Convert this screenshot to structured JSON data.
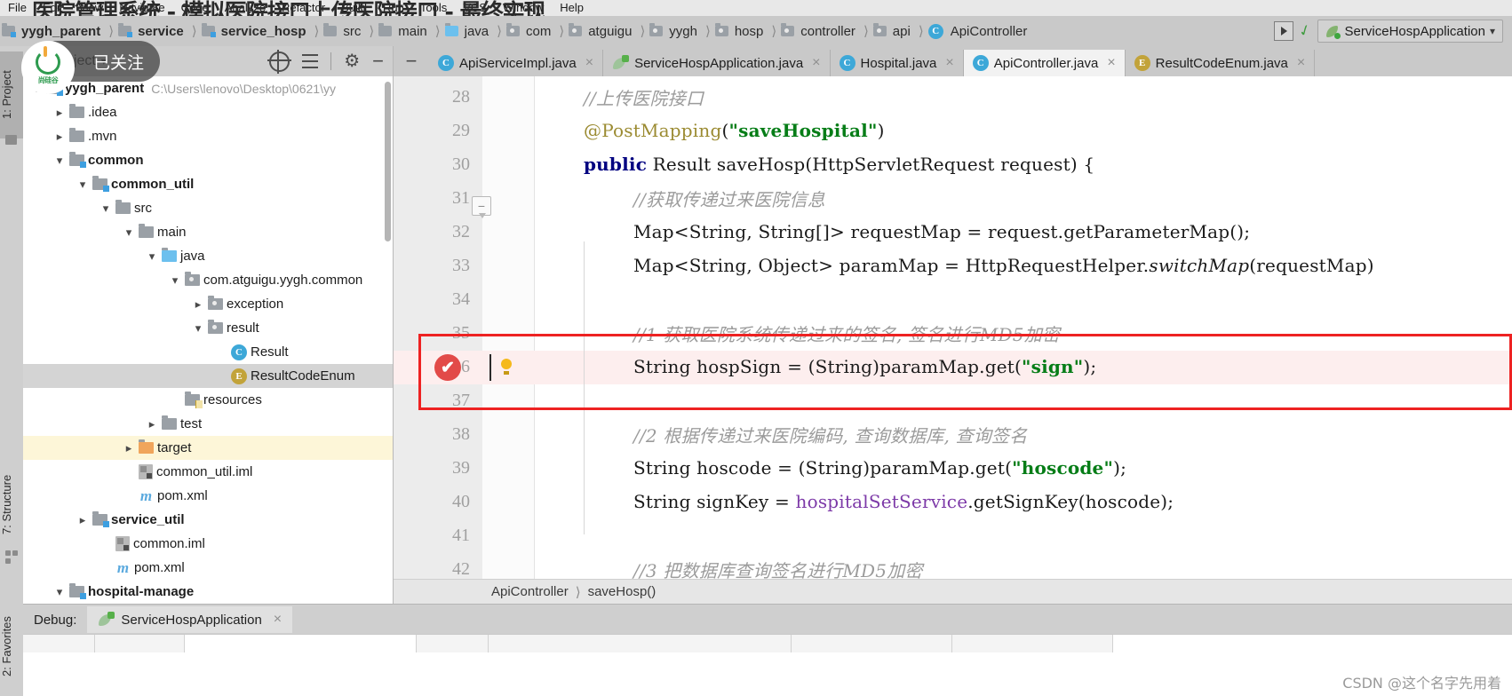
{
  "window": {
    "menu_items": [
      "File",
      "Edit",
      "View",
      "Navigate",
      "Code",
      "Analyze",
      "Refactor",
      "Build",
      "Run",
      "Tools",
      "VCS",
      "Window",
      "Help"
    ],
    "overlay_title": "医院管理系统 - 模拟医院接口上传医院接口 - 最终实现"
  },
  "breadcrumb": {
    "items": [
      {
        "label": "yygh_parent",
        "icon": "module-folder-icon",
        "bold": true
      },
      {
        "label": "service",
        "icon": "module-folder-icon",
        "bold": true
      },
      {
        "label": "service_hosp",
        "icon": "module-folder-icon",
        "bold": true
      },
      {
        "label": "src",
        "icon": "folder-icon",
        "bold": false
      },
      {
        "label": "main",
        "icon": "folder-icon",
        "bold": false
      },
      {
        "label": "java",
        "icon": "source-folder-icon",
        "bold": false
      },
      {
        "label": "com",
        "icon": "package-icon",
        "bold": false
      },
      {
        "label": "atguigu",
        "icon": "package-icon",
        "bold": false
      },
      {
        "label": "yygh",
        "icon": "package-icon",
        "bold": false
      },
      {
        "label": "hosp",
        "icon": "package-icon",
        "bold": false
      },
      {
        "label": "controller",
        "icon": "package-icon",
        "bold": false
      },
      {
        "label": "api",
        "icon": "package-icon",
        "bold": false
      },
      {
        "label": "ApiController",
        "icon": "class-icon",
        "bold": false
      }
    ],
    "run_config": "ServiceHospApplication"
  },
  "toolwindows": {
    "project_tab": "1: Project",
    "structure_tab": "7: Structure",
    "favorites_tab": "2: Favorites"
  },
  "project_panel": {
    "title": "Project",
    "tree": [
      {
        "depth": 0,
        "twisty": "v",
        "icon": "module-folder-icon",
        "label": "yygh_parent",
        "bold": true,
        "path": "C:\\Users\\lenovo\\Desktop\\0621\\yy",
        "state": "normal"
      },
      {
        "depth": 1,
        "twisty": ">",
        "icon": "folder-icon",
        "label": ".idea",
        "bold": false,
        "path": "",
        "state": "normal"
      },
      {
        "depth": 1,
        "twisty": ">",
        "icon": "folder-icon",
        "label": ".mvn",
        "bold": false,
        "path": "",
        "state": "normal"
      },
      {
        "depth": 1,
        "twisty": "v",
        "icon": "module-folder-icon",
        "label": "common",
        "bold": true,
        "path": "",
        "state": "normal"
      },
      {
        "depth": 2,
        "twisty": "v",
        "icon": "module-folder-icon",
        "label": "common_util",
        "bold": true,
        "path": "",
        "state": "normal"
      },
      {
        "depth": 3,
        "twisty": "v",
        "icon": "folder-icon",
        "label": "src",
        "bold": false,
        "path": "",
        "state": "normal"
      },
      {
        "depth": 4,
        "twisty": "v",
        "icon": "folder-icon",
        "label": "main",
        "bold": false,
        "path": "",
        "state": "normal"
      },
      {
        "depth": 5,
        "twisty": "v",
        "icon": "source-folder-icon",
        "label": "java",
        "bold": false,
        "path": "",
        "state": "normal"
      },
      {
        "depth": 6,
        "twisty": "v",
        "icon": "package-icon",
        "label": "com.atguigu.yygh.common",
        "bold": false,
        "path": "",
        "state": "normal"
      },
      {
        "depth": 7,
        "twisty": ">",
        "icon": "package-icon",
        "label": "exception",
        "bold": false,
        "path": "",
        "state": "normal"
      },
      {
        "depth": 7,
        "twisty": "v",
        "icon": "package-icon",
        "label": "result",
        "bold": false,
        "path": "",
        "state": "normal"
      },
      {
        "depth": 8,
        "twisty": "",
        "icon": "class-icon",
        "label": "Result",
        "bold": false,
        "path": "",
        "state": "normal"
      },
      {
        "depth": 8,
        "twisty": "",
        "icon": "enum-icon",
        "label": "ResultCodeEnum",
        "bold": false,
        "path": "",
        "state": "selected"
      },
      {
        "depth": 6,
        "twisty": "",
        "icon": "resources-folder-icon",
        "label": "resources",
        "bold": false,
        "path": "",
        "state": "normal"
      },
      {
        "depth": 5,
        "twisty": ">",
        "icon": "folder-icon",
        "label": "test",
        "bold": false,
        "path": "",
        "state": "normal"
      },
      {
        "depth": 4,
        "twisty": ">",
        "icon": "target-folder-icon",
        "label": "target",
        "bold": false,
        "path": "",
        "state": "highlighted"
      },
      {
        "depth": 4,
        "twisty": "",
        "icon": "iml-icon",
        "label": "common_util.iml",
        "bold": false,
        "path": "",
        "state": "normal"
      },
      {
        "depth": 4,
        "twisty": "",
        "icon": "maven-icon",
        "label": "pom.xml",
        "bold": false,
        "path": "",
        "state": "normal"
      },
      {
        "depth": 2,
        "twisty": ">",
        "icon": "module-folder-icon",
        "label": "service_util",
        "bold": true,
        "path": "",
        "state": "normal"
      },
      {
        "depth": 3,
        "twisty": "",
        "icon": "iml-icon",
        "label": "common.iml",
        "bold": false,
        "path": "",
        "state": "normal"
      },
      {
        "depth": 3,
        "twisty": "",
        "icon": "maven-icon",
        "label": "pom.xml",
        "bold": false,
        "path": "",
        "state": "normal"
      },
      {
        "depth": 1,
        "twisty": "v",
        "icon": "module-folder-icon",
        "label": "hospital-manage",
        "bold": true,
        "path": "",
        "state": "normal"
      }
    ]
  },
  "editor": {
    "tabs": [
      {
        "label": "ApiServiceImpl.java",
        "icon": "class-icon",
        "active": false
      },
      {
        "label": "ServiceHospApplication.java",
        "icon": "spring-boot-icon",
        "active": false
      },
      {
        "label": "Hospital.java",
        "icon": "class-icon",
        "active": false
      },
      {
        "label": "ApiController.java",
        "icon": "class-icon",
        "active": true
      },
      {
        "label": "ResultCodeEnum.java",
        "icon": "enum-icon",
        "active": false
      }
    ],
    "code_lines": [
      {
        "num": "28",
        "indent": 1,
        "tokens": [
          {
            "t": "//上传医院接口",
            "c": "cmt"
          }
        ]
      },
      {
        "num": "29",
        "indent": 1,
        "tokens": [
          {
            "t": "@PostMapping",
            "c": "ann"
          },
          {
            "t": "(",
            "c": ""
          },
          {
            "t": "\"saveHospital\"",
            "c": "str"
          },
          {
            "t": ")",
            "c": ""
          }
        ]
      },
      {
        "num": "30",
        "indent": 1,
        "tokens": [
          {
            "t": "public",
            "c": "kw"
          },
          {
            "t": " Result saveHosp(HttpServletRequest request) {",
            "c": ""
          }
        ]
      },
      {
        "num": "31",
        "indent": 2,
        "tokens": [
          {
            "t": "//获取传递过来医院信息",
            "c": "cmt"
          }
        ]
      },
      {
        "num": "32",
        "indent": 2,
        "tokens": [
          {
            "t": "Map<String, String[]> requestMap = request.getParameterMap();",
            "c": ""
          }
        ]
      },
      {
        "num": "33",
        "indent": 2,
        "tokens": [
          {
            "t": "Map<String, Object> paramMap = HttpRequestHelper.",
            "c": ""
          },
          {
            "t": "switchMap",
            "c": "mthi"
          },
          {
            "t": "(requestMap)",
            "c": ""
          }
        ]
      },
      {
        "num": "34",
        "indent": 2,
        "tokens": []
      },
      {
        "num": "35",
        "indent": 2,
        "tokens": [
          {
            "t": "//1 获取医院系统传递过来的签名, 签名进行MD5加密",
            "c": "cmt"
          }
        ]
      },
      {
        "num": "36",
        "indent": 2,
        "tokens": [
          {
            "t": "String hospSign = (String)paramMap.get(",
            "c": ""
          },
          {
            "t": "\"sign\"",
            "c": "str"
          },
          {
            "t": ");",
            "c": ""
          }
        ]
      },
      {
        "num": "37",
        "indent": 2,
        "tokens": []
      },
      {
        "num": "38",
        "indent": 2,
        "tokens": [
          {
            "t": "//2 根据传递过来医院编码, 查询数据库, 查询签名",
            "c": "cmt"
          }
        ]
      },
      {
        "num": "39",
        "indent": 2,
        "tokens": [
          {
            "t": "String hoscode = (String)paramMap.get(",
            "c": ""
          },
          {
            "t": "\"hoscode\"",
            "c": "str"
          },
          {
            "t": ");",
            "c": ""
          }
        ]
      },
      {
        "num": "40",
        "indent": 2,
        "tokens": [
          {
            "t": "String signKey = ",
            "c": ""
          },
          {
            "t": "hospitalSetService",
            "c": "fld"
          },
          {
            "t": ".getSignKey(hoscode);",
            "c": ""
          }
        ]
      },
      {
        "num": "41",
        "indent": 2,
        "tokens": []
      },
      {
        "num": "42",
        "indent": 2,
        "tokens": [
          {
            "t": "//3 把数据库查询签名进行MD5加密",
            "c": "cmt"
          }
        ]
      }
    ],
    "breakpoint_line": "36",
    "highlight_color": "#ee2222"
  },
  "editor_breadcrumb": {
    "class_name": "ApiController",
    "method_name": "saveHosp()"
  },
  "debug_panel": {
    "label": "Debug:",
    "session": "ServiceHospApplication"
  },
  "overlay": {
    "follow_label": "已关注",
    "watermark": "CSDN @这个名字先用着",
    "avatar_text": "尚硅谷"
  }
}
